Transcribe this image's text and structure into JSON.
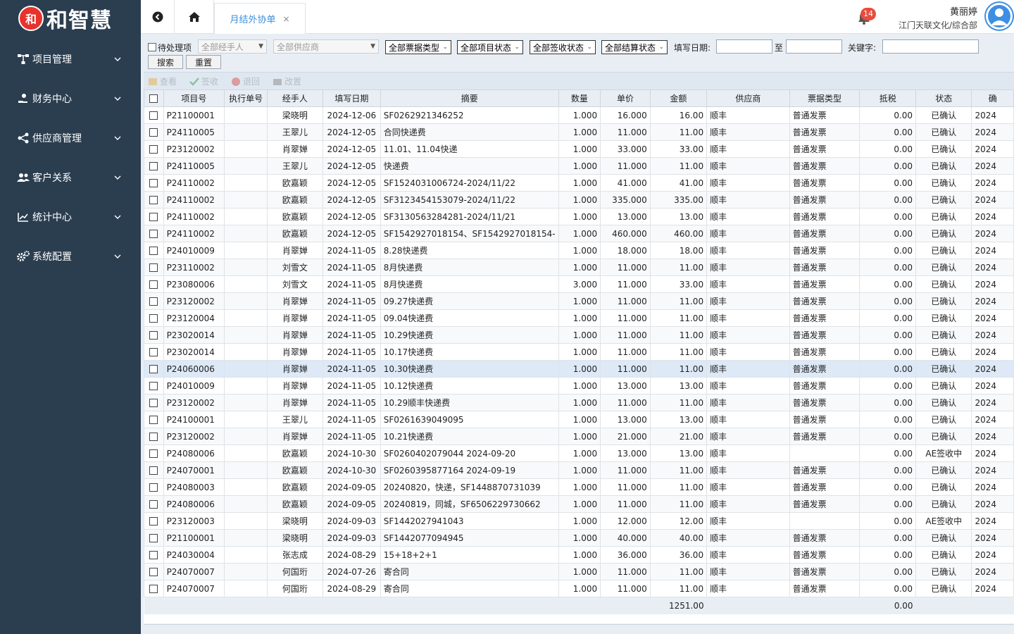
{
  "brand": {
    "name": "和智慧",
    "mark": "和"
  },
  "sidebar": {
    "items": [
      {
        "label": "项目管理",
        "icon": "sitemap-icon"
      },
      {
        "label": "财务中心",
        "icon": "hand-coin-icon"
      },
      {
        "label": "供应商管理",
        "icon": "share-nodes-icon"
      },
      {
        "label": "客户关系",
        "icon": "users-icon"
      },
      {
        "label": "统计中心",
        "icon": "line-chart-icon"
      },
      {
        "label": "系统配置",
        "icon": "gears-icon"
      }
    ]
  },
  "header": {
    "tab_label": "月结外协单",
    "tab_close": "×",
    "notifications": "14",
    "user_name": "黄丽婷",
    "user_org": "江门天联文化/综合部"
  },
  "filters": {
    "pending_label": "待处理项",
    "handler": "全部经手人",
    "supplier": "全部供应商",
    "ticket_type": "全部票据类型",
    "project_status": "全部项目状态",
    "sign_status": "全部签收状态",
    "settle_status": "全部结算状态",
    "date_label": "填写日期:",
    "to_label": "至",
    "keyword_label": "关键字:",
    "search_btn": "搜索",
    "reset_btn": "重置"
  },
  "toolbar": {
    "view": "查看",
    "sign": "签收",
    "return": "退回",
    "edit": "改置"
  },
  "table": {
    "columns": [
      "项目号",
      "执行单号",
      "经手人",
      "填写日期",
      "摘要",
      "数量",
      "单价",
      "金额",
      "供应商",
      "票据类型",
      "抵税",
      "状态",
      "确"
    ],
    "rows": [
      [
        "P21100001",
        "",
        "梁晓明",
        "2024-12-06",
        "SF0262921346252",
        "1.000",
        "16.000",
        "16.00",
        "顺丰",
        "普通发票",
        "0.00",
        "已确认",
        "2024"
      ],
      [
        "P24110005",
        "",
        "王翠儿",
        "2024-12-05",
        "合同快递费",
        "1.000",
        "11.000",
        "11.00",
        "顺丰",
        "普通发票",
        "0.00",
        "已确认",
        "2024"
      ],
      [
        "P23120002",
        "",
        "肖翠婵",
        "2024-12-05",
        "11.01、11.04快递",
        "1.000",
        "33.000",
        "33.00",
        "顺丰",
        "普通发票",
        "0.00",
        "已确认",
        "2024"
      ],
      [
        "P24110005",
        "",
        "王翠儿",
        "2024-12-05",
        "快递费",
        "1.000",
        "11.000",
        "11.00",
        "顺丰",
        "普通发票",
        "0.00",
        "已确认",
        "2024"
      ],
      [
        "P24110002",
        "",
        "欧嘉颖",
        "2024-12-05",
        "SF1524031006724-2024/11/22",
        "1.000",
        "41.000",
        "41.00",
        "顺丰",
        "普通发票",
        "0.00",
        "已确认",
        "2024"
      ],
      [
        "P24110002",
        "",
        "欧嘉颖",
        "2024-12-05",
        "SF3123454153079-2024/11/22",
        "1.000",
        "335.000",
        "335.00",
        "顺丰",
        "普通发票",
        "0.00",
        "已确认",
        "2024"
      ],
      [
        "P24110002",
        "",
        "欧嘉颖",
        "2024-12-05",
        "SF3130563284281-2024/11/21",
        "1.000",
        "13.000",
        "13.00",
        "顺丰",
        "普通发票",
        "0.00",
        "已确认",
        "2024"
      ],
      [
        "P24110002",
        "",
        "欧嘉颖",
        "2024-12-05",
        "SF1542927018154、SF1542927018154-",
        "1.000",
        "460.000",
        "460.00",
        "顺丰",
        "普通发票",
        "0.00",
        "已确认",
        "2024"
      ],
      [
        "P24010009",
        "",
        "肖翠婵",
        "2024-11-05",
        "8.28快递费",
        "1.000",
        "18.000",
        "18.00",
        "顺丰",
        "普通发票",
        "0.00",
        "已确认",
        "2024"
      ],
      [
        "P23110002",
        "",
        "刘雪文",
        "2024-11-05",
        "8月快递费",
        "1.000",
        "11.000",
        "11.00",
        "顺丰",
        "普通发票",
        "0.00",
        "已确认",
        "2024"
      ],
      [
        "P23080006",
        "",
        "刘雪文",
        "2024-11-05",
        "8月快递费",
        "3.000",
        "11.000",
        "33.00",
        "顺丰",
        "普通发票",
        "0.00",
        "已确认",
        "2024"
      ],
      [
        "P23120002",
        "",
        "肖翠婵",
        "2024-11-05",
        "09.27快递费",
        "1.000",
        "11.000",
        "11.00",
        "顺丰",
        "普通发票",
        "0.00",
        "已确认",
        "2024"
      ],
      [
        "P23120004",
        "",
        "肖翠婵",
        "2024-11-05",
        "09.04快递费",
        "1.000",
        "11.000",
        "11.00",
        "顺丰",
        "普通发票",
        "0.00",
        "已确认",
        "2024"
      ],
      [
        "P23020014",
        "",
        "肖翠婵",
        "2024-11-05",
        "10.29快递费",
        "1.000",
        "11.000",
        "11.00",
        "顺丰",
        "普通发票",
        "0.00",
        "已确认",
        "2024"
      ],
      [
        "P23020014",
        "",
        "肖翠婵",
        "2024-11-05",
        "10.17快递费",
        "1.000",
        "11.000",
        "11.00",
        "顺丰",
        "普通发票",
        "0.00",
        "已确认",
        "2024"
      ],
      [
        "P24060006",
        "",
        "肖翠婵",
        "2024-11-05",
        "10.30快递费",
        "1.000",
        "11.000",
        "11.00",
        "顺丰",
        "普通发票",
        "0.00",
        "已确认",
        "2024"
      ],
      [
        "P24010009",
        "",
        "肖翠婵",
        "2024-11-05",
        "10.12快递费",
        "1.000",
        "13.000",
        "13.00",
        "顺丰",
        "普通发票",
        "0.00",
        "已确认",
        "2024"
      ],
      [
        "P23120002",
        "",
        "肖翠婵",
        "2024-11-05",
        "10.29顺丰快递费",
        "1.000",
        "11.000",
        "11.00",
        "顺丰",
        "普通发票",
        "0.00",
        "已确认",
        "2024"
      ],
      [
        "P24100001",
        "",
        "王翠儿",
        "2024-11-05",
        "SF0261639049095",
        "1.000",
        "13.000",
        "13.00",
        "顺丰",
        "普通发票",
        "0.00",
        "已确认",
        "2024"
      ],
      [
        "P23120002",
        "",
        "肖翠婵",
        "2024-11-05",
        "10.21快递费",
        "1.000",
        "21.000",
        "21.00",
        "顺丰",
        "普通发票",
        "0.00",
        "已确认",
        "2024"
      ],
      [
        "P24080006",
        "",
        "欧嘉颖",
        "2024-10-30",
        "SF0260402079044 2024-09-20",
        "1.000",
        "13.000",
        "13.00",
        "顺丰",
        "",
        "0.00",
        "AE签收中",
        "2024"
      ],
      [
        "P24070001",
        "",
        "欧嘉颖",
        "2024-10-30",
        "SF0260395877164 2024-09-19",
        "1.000",
        "11.000",
        "11.00",
        "顺丰",
        "普通发票",
        "0.00",
        "已确认",
        "2024"
      ],
      [
        "P24080003",
        "",
        "欧嘉颖",
        "2024-09-05",
        "20240820，快递，SF1448870731039",
        "1.000",
        "11.000",
        "11.00",
        "顺丰",
        "普通发票",
        "0.00",
        "已确认",
        "2024"
      ],
      [
        "P24080006",
        "",
        "欧嘉颖",
        "2024-09-05",
        "20240819，同城，SF6506229730662",
        "1.000",
        "11.000",
        "11.00",
        "顺丰",
        "普通发票",
        "0.00",
        "已确认",
        "2024"
      ],
      [
        "P23120003",
        "",
        "梁晓明",
        "2024-09-03",
        "SF1442027941043",
        "1.000",
        "12.000",
        "12.00",
        "顺丰",
        "",
        "0.00",
        "AE签收中",
        "2024"
      ],
      [
        "P21100001",
        "",
        "梁晓明",
        "2024-09-03",
        "SF1442077094945",
        "1.000",
        "40.000",
        "40.00",
        "顺丰",
        "普通发票",
        "0.00",
        "已确认",
        "2024"
      ],
      [
        "P24030004",
        "",
        "张志成",
        "2024-08-29",
        "15+18+2+1",
        "1.000",
        "36.000",
        "36.00",
        "顺丰",
        "普通发票",
        "0.00",
        "已确认",
        "2024"
      ],
      [
        "P24070007",
        "",
        "何国珩",
        "2024-07-26",
        "寄合同",
        "1.000",
        "11.000",
        "11.00",
        "顺丰",
        "普通发票",
        "0.00",
        "已确认",
        "2024"
      ],
      [
        "P24070007",
        "",
        "何国珩",
        "2024-08-29",
        "寄合同",
        "1.000",
        "11.000",
        "11.00",
        "顺丰",
        "普通发票",
        "0.00",
        "已确认",
        "2024"
      ]
    ],
    "selected_row": 15,
    "totals": {
      "amount": "1251.00",
      "tax": "0.00"
    }
  },
  "colors": {
    "sidebar": "#2b3e50",
    "accent": "#3b8fd9",
    "badge": "#e84c3d"
  }
}
